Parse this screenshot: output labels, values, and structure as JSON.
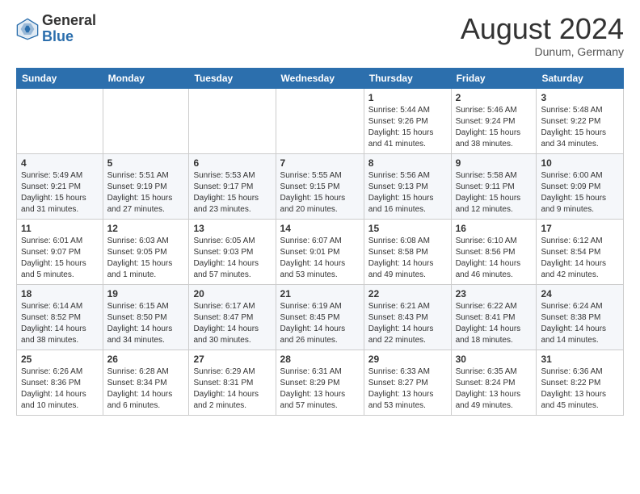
{
  "header": {
    "logo_general": "General",
    "logo_blue": "Blue",
    "month_title": "August 2024",
    "location": "Dunum, Germany"
  },
  "days_of_week": [
    "Sunday",
    "Monday",
    "Tuesday",
    "Wednesday",
    "Thursday",
    "Friday",
    "Saturday"
  ],
  "weeks": [
    [
      {
        "num": "",
        "sunrise": "",
        "sunset": "",
        "daylight": ""
      },
      {
        "num": "",
        "sunrise": "",
        "sunset": "",
        "daylight": ""
      },
      {
        "num": "",
        "sunrise": "",
        "sunset": "",
        "daylight": ""
      },
      {
        "num": "",
        "sunrise": "",
        "sunset": "",
        "daylight": ""
      },
      {
        "num": "1",
        "sunrise": "Sunrise: 5:44 AM",
        "sunset": "Sunset: 9:26 PM",
        "daylight": "Daylight: 15 hours and 41 minutes."
      },
      {
        "num": "2",
        "sunrise": "Sunrise: 5:46 AM",
        "sunset": "Sunset: 9:24 PM",
        "daylight": "Daylight: 15 hours and 38 minutes."
      },
      {
        "num": "3",
        "sunrise": "Sunrise: 5:48 AM",
        "sunset": "Sunset: 9:22 PM",
        "daylight": "Daylight: 15 hours and 34 minutes."
      }
    ],
    [
      {
        "num": "4",
        "sunrise": "Sunrise: 5:49 AM",
        "sunset": "Sunset: 9:21 PM",
        "daylight": "Daylight: 15 hours and 31 minutes."
      },
      {
        "num": "5",
        "sunrise": "Sunrise: 5:51 AM",
        "sunset": "Sunset: 9:19 PM",
        "daylight": "Daylight: 15 hours and 27 minutes."
      },
      {
        "num": "6",
        "sunrise": "Sunrise: 5:53 AM",
        "sunset": "Sunset: 9:17 PM",
        "daylight": "Daylight: 15 hours and 23 minutes."
      },
      {
        "num": "7",
        "sunrise": "Sunrise: 5:55 AM",
        "sunset": "Sunset: 9:15 PM",
        "daylight": "Daylight: 15 hours and 20 minutes."
      },
      {
        "num": "8",
        "sunrise": "Sunrise: 5:56 AM",
        "sunset": "Sunset: 9:13 PM",
        "daylight": "Daylight: 15 hours and 16 minutes."
      },
      {
        "num": "9",
        "sunrise": "Sunrise: 5:58 AM",
        "sunset": "Sunset: 9:11 PM",
        "daylight": "Daylight: 15 hours and 12 minutes."
      },
      {
        "num": "10",
        "sunrise": "Sunrise: 6:00 AM",
        "sunset": "Sunset: 9:09 PM",
        "daylight": "Daylight: 15 hours and 9 minutes."
      }
    ],
    [
      {
        "num": "11",
        "sunrise": "Sunrise: 6:01 AM",
        "sunset": "Sunset: 9:07 PM",
        "daylight": "Daylight: 15 hours and 5 minutes."
      },
      {
        "num": "12",
        "sunrise": "Sunrise: 6:03 AM",
        "sunset": "Sunset: 9:05 PM",
        "daylight": "Daylight: 15 hours and 1 minute."
      },
      {
        "num": "13",
        "sunrise": "Sunrise: 6:05 AM",
        "sunset": "Sunset: 9:03 PM",
        "daylight": "Daylight: 14 hours and 57 minutes."
      },
      {
        "num": "14",
        "sunrise": "Sunrise: 6:07 AM",
        "sunset": "Sunset: 9:01 PM",
        "daylight": "Daylight: 14 hours and 53 minutes."
      },
      {
        "num": "15",
        "sunrise": "Sunrise: 6:08 AM",
        "sunset": "Sunset: 8:58 PM",
        "daylight": "Daylight: 14 hours and 49 minutes."
      },
      {
        "num": "16",
        "sunrise": "Sunrise: 6:10 AM",
        "sunset": "Sunset: 8:56 PM",
        "daylight": "Daylight: 14 hours and 46 minutes."
      },
      {
        "num": "17",
        "sunrise": "Sunrise: 6:12 AM",
        "sunset": "Sunset: 8:54 PM",
        "daylight": "Daylight: 14 hours and 42 minutes."
      }
    ],
    [
      {
        "num": "18",
        "sunrise": "Sunrise: 6:14 AM",
        "sunset": "Sunset: 8:52 PM",
        "daylight": "Daylight: 14 hours and 38 minutes."
      },
      {
        "num": "19",
        "sunrise": "Sunrise: 6:15 AM",
        "sunset": "Sunset: 8:50 PM",
        "daylight": "Daylight: 14 hours and 34 minutes."
      },
      {
        "num": "20",
        "sunrise": "Sunrise: 6:17 AM",
        "sunset": "Sunset: 8:47 PM",
        "daylight": "Daylight: 14 hours and 30 minutes."
      },
      {
        "num": "21",
        "sunrise": "Sunrise: 6:19 AM",
        "sunset": "Sunset: 8:45 PM",
        "daylight": "Daylight: 14 hours and 26 minutes."
      },
      {
        "num": "22",
        "sunrise": "Sunrise: 6:21 AM",
        "sunset": "Sunset: 8:43 PM",
        "daylight": "Daylight: 14 hours and 22 minutes."
      },
      {
        "num": "23",
        "sunrise": "Sunrise: 6:22 AM",
        "sunset": "Sunset: 8:41 PM",
        "daylight": "Daylight: 14 hours and 18 minutes."
      },
      {
        "num": "24",
        "sunrise": "Sunrise: 6:24 AM",
        "sunset": "Sunset: 8:38 PM",
        "daylight": "Daylight: 14 hours and 14 minutes."
      }
    ],
    [
      {
        "num": "25",
        "sunrise": "Sunrise: 6:26 AM",
        "sunset": "Sunset: 8:36 PM",
        "daylight": "Daylight: 14 hours and 10 minutes."
      },
      {
        "num": "26",
        "sunrise": "Sunrise: 6:28 AM",
        "sunset": "Sunset: 8:34 PM",
        "daylight": "Daylight: 14 hours and 6 minutes."
      },
      {
        "num": "27",
        "sunrise": "Sunrise: 6:29 AM",
        "sunset": "Sunset: 8:31 PM",
        "daylight": "Daylight: 14 hours and 2 minutes."
      },
      {
        "num": "28",
        "sunrise": "Sunrise: 6:31 AM",
        "sunset": "Sunset: 8:29 PM",
        "daylight": "Daylight: 13 hours and 57 minutes."
      },
      {
        "num": "29",
        "sunrise": "Sunrise: 6:33 AM",
        "sunset": "Sunset: 8:27 PM",
        "daylight": "Daylight: 13 hours and 53 minutes."
      },
      {
        "num": "30",
        "sunrise": "Sunrise: 6:35 AM",
        "sunset": "Sunset: 8:24 PM",
        "daylight": "Daylight: 13 hours and 49 minutes."
      },
      {
        "num": "31",
        "sunrise": "Sunrise: 6:36 AM",
        "sunset": "Sunset: 8:22 PM",
        "daylight": "Daylight: 13 hours and 45 minutes."
      }
    ]
  ]
}
